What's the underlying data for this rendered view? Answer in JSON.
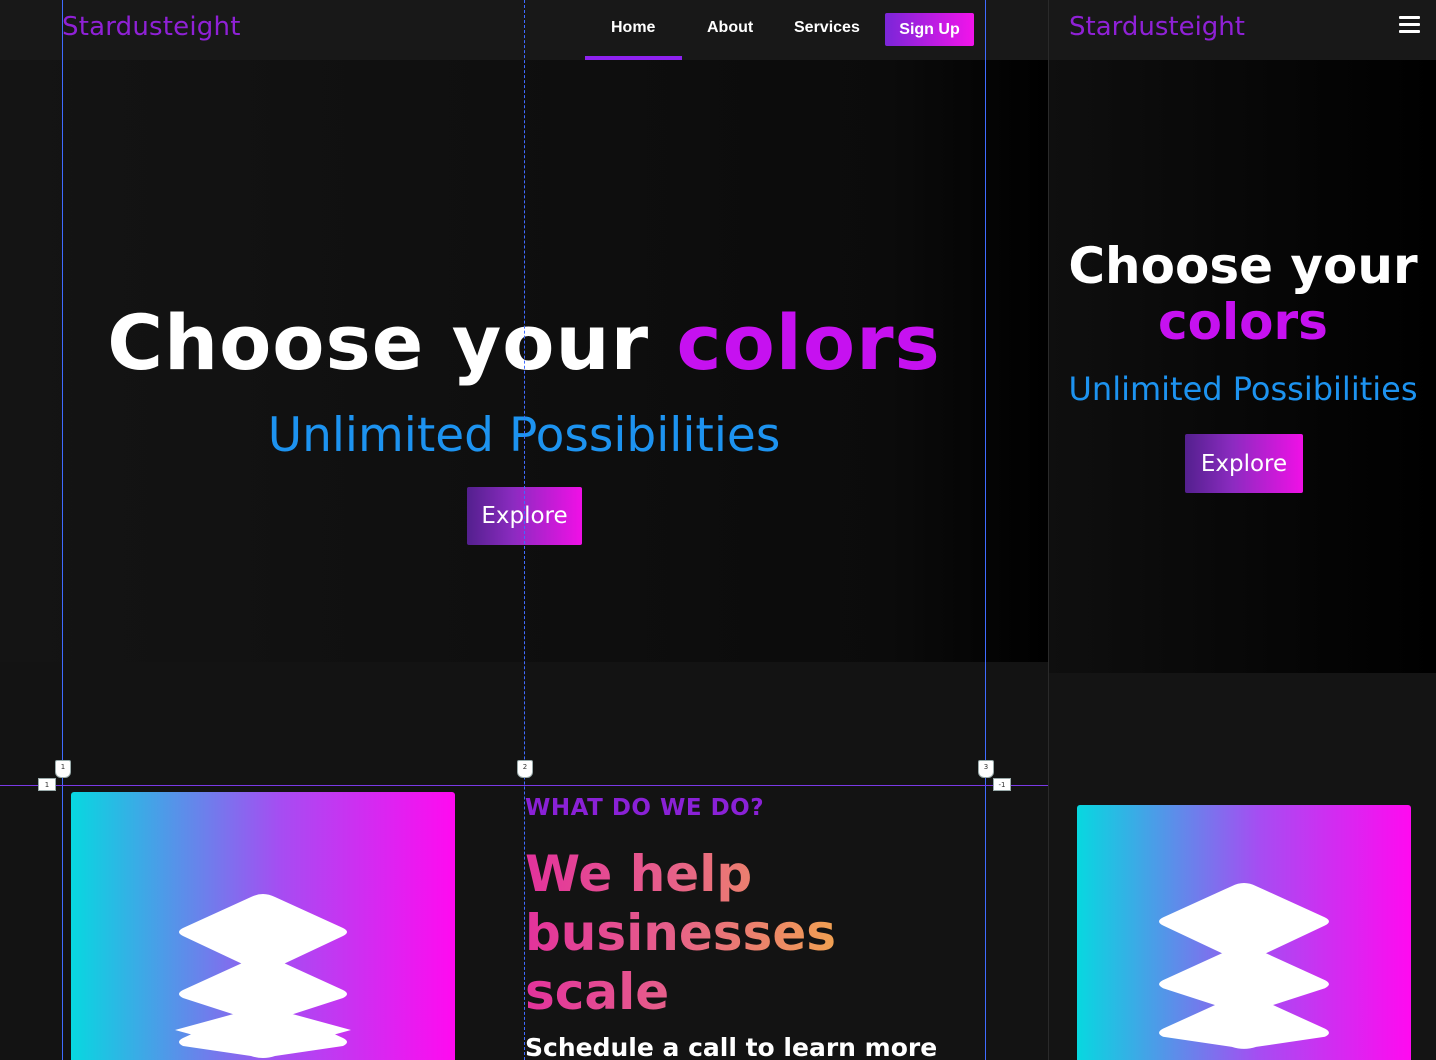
{
  "brand": {
    "name": "Stardusteight"
  },
  "nav": {
    "home": "Home",
    "about": "About",
    "services": "Services",
    "signup": "Sign Up"
  },
  "hero": {
    "title_main": "Choose your",
    "title_accent": "colors",
    "subtitle": "Unlimited Possibilities",
    "cta": "Explore"
  },
  "features": {
    "eyebrow": "WHAT DO WE DO?",
    "headline": "We help businesses scale",
    "cta_text": "Schedule a call to learn more"
  },
  "guides": {
    "top_markers": [
      "1",
      "2",
      "3"
    ],
    "side_markers": [
      "1",
      "-1"
    ]
  },
  "icons": {
    "feature": "layers-icon",
    "menu": "hamburger-menu-icon"
  },
  "colors": {
    "brand_purple": "#8f21d6",
    "accent_magenta": "#c611f0",
    "subtitle_blue": "#1d93f0",
    "gradient_start": "#07d8e0",
    "gradient_end": "#ff0af0"
  }
}
